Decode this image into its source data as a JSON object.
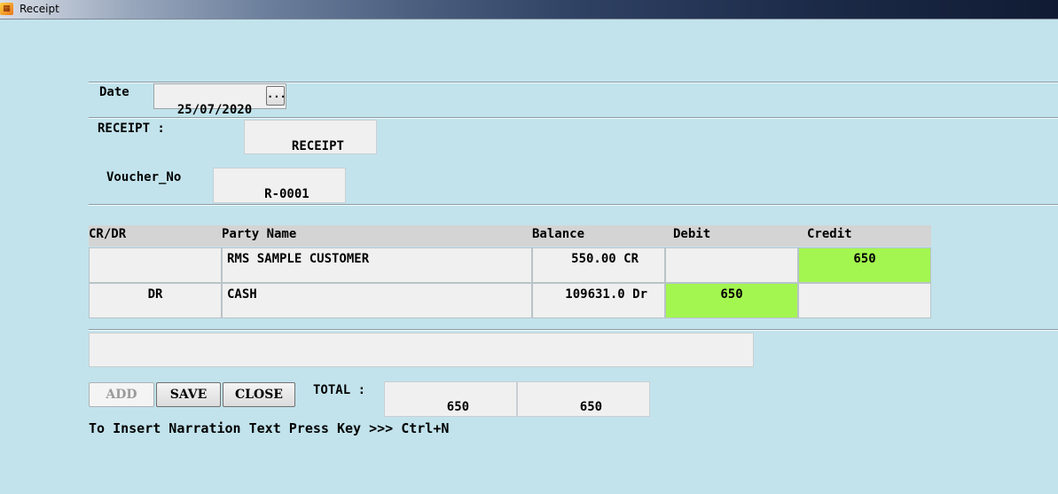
{
  "window": {
    "title": "Receipt",
    "icon": "app-icon"
  },
  "form": {
    "date_label": "Date",
    "date_value": "25/07/2020",
    "date_picker_label": "...",
    "receipt_label": "RECEIPT :",
    "receipt_type": "RECEIPT",
    "voucher_label": "Voucher_No",
    "voucher_value": "R-0001"
  },
  "table": {
    "headers": [
      "CR/DR",
      "Party Name",
      "Balance",
      "Debit",
      "Credit"
    ],
    "rows": [
      {
        "crdr": "",
        "party": "RMS SAMPLE CUSTOMER",
        "balance": "550.00 CR",
        "debit": "",
        "credit": "650"
      },
      {
        "crdr": "DR",
        "party": "CASH",
        "balance": "109631.0 Dr",
        "debit": "650",
        "credit": ""
      }
    ],
    "highlight_color": "#a3f650"
  },
  "narration": {
    "value": ""
  },
  "actions": {
    "add_label": "ADD",
    "save_label": "SAVE",
    "close_label": "CLOSE"
  },
  "totals": {
    "label": "TOTAL :",
    "debit_total": "650",
    "credit_total": "650"
  },
  "hint": "To Insert Narration Text Press Key >>> Ctrl+N"
}
